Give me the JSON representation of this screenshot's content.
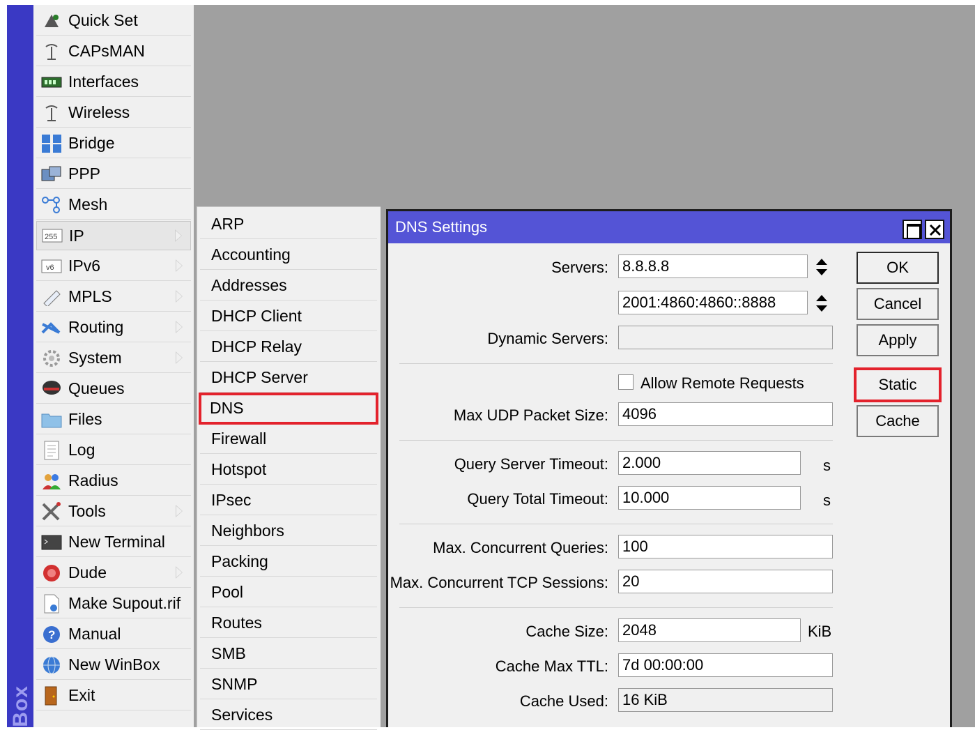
{
  "app": {
    "vertical_label": "Box"
  },
  "menu": {
    "items": [
      {
        "label": "Quick Set",
        "icon": "quick-set-icon",
        "submenu": false
      },
      {
        "label": "CAPsMAN",
        "icon": "antenna-icon",
        "submenu": false
      },
      {
        "label": "Interfaces",
        "icon": "interfaces-icon",
        "submenu": false
      },
      {
        "label": "Wireless",
        "icon": "wireless-icon",
        "submenu": false
      },
      {
        "label": "Bridge",
        "icon": "bridge-icon",
        "submenu": false
      },
      {
        "label": "PPP",
        "icon": "ppp-icon",
        "submenu": false
      },
      {
        "label": "Mesh",
        "icon": "mesh-icon",
        "submenu": false
      },
      {
        "label": "IP",
        "icon": "ip-icon",
        "submenu": true
      },
      {
        "label": "IPv6",
        "icon": "ipv6-icon",
        "submenu": true
      },
      {
        "label": "MPLS",
        "icon": "mpls-icon",
        "submenu": true
      },
      {
        "label": "Routing",
        "icon": "routing-icon",
        "submenu": true
      },
      {
        "label": "System",
        "icon": "system-gear-icon",
        "submenu": true
      },
      {
        "label": "Queues",
        "icon": "queues-icon",
        "submenu": false
      },
      {
        "label": "Files",
        "icon": "folder-icon",
        "submenu": false
      },
      {
        "label": "Log",
        "icon": "log-icon",
        "submenu": false
      },
      {
        "label": "Radius",
        "icon": "radius-users-icon",
        "submenu": false
      },
      {
        "label": "Tools",
        "icon": "tools-icon",
        "submenu": true
      },
      {
        "label": "New Terminal",
        "icon": "terminal-icon",
        "submenu": false
      },
      {
        "label": "Dude",
        "icon": "dude-icon",
        "submenu": true
      },
      {
        "label": "Make Supout.rif",
        "icon": "supout-file-icon",
        "submenu": false
      },
      {
        "label": "Manual",
        "icon": "help-icon",
        "submenu": false
      },
      {
        "label": "New WinBox",
        "icon": "winbox-globe-icon",
        "submenu": false
      },
      {
        "label": "Exit",
        "icon": "exit-door-icon",
        "submenu": false
      }
    ]
  },
  "submenu": {
    "items": [
      "ARP",
      "Accounting",
      "Addresses",
      "DHCP Client",
      "DHCP Relay",
      "DHCP Server",
      "DNS",
      "Firewall",
      "Hotspot",
      "IPsec",
      "Neighbors",
      "Packing",
      "Pool",
      "Routes",
      "SMB",
      "SNMP",
      "Services"
    ],
    "highlighted": "DNS"
  },
  "dialog": {
    "title": "DNS Settings",
    "fields": {
      "servers_label": "Servers:",
      "server1": "8.8.8.8",
      "server2": "2001:4860:4860::8888",
      "dynamic_servers_label": "Dynamic Servers:",
      "dynamic_servers": "",
      "allow_remote_label": "Allow Remote Requests",
      "allow_remote_checked": false,
      "max_udp_label": "Max UDP Packet Size:",
      "max_udp": "4096",
      "query_server_timeout_label": "Query Server Timeout:",
      "query_server_timeout": "2.000",
      "query_total_timeout_label": "Query Total Timeout:",
      "query_total_timeout": "10.000",
      "seconds_unit": "s",
      "max_concurrent_queries_label": "Max. Concurrent Queries:",
      "max_concurrent_queries": "100",
      "max_concurrent_tcp_label": "Max. Concurrent TCP Sessions:",
      "max_concurrent_tcp": "20",
      "cache_size_label": "Cache Size:",
      "cache_size": "2048",
      "kib_unit": "KiB",
      "cache_max_ttl_label": "Cache Max TTL:",
      "cache_max_ttl": "7d 00:00:00",
      "cache_used_label": "Cache Used:",
      "cache_used": "16 KiB"
    },
    "buttons": {
      "ok": "OK",
      "cancel": "Cancel",
      "apply": "Apply",
      "static": "Static",
      "cache": "Cache"
    }
  },
  "colors": {
    "title_bar": "#5454d6",
    "highlight": "#e3222c",
    "side_bar": "#3a39c4",
    "desktop": "#a0a0a0"
  }
}
